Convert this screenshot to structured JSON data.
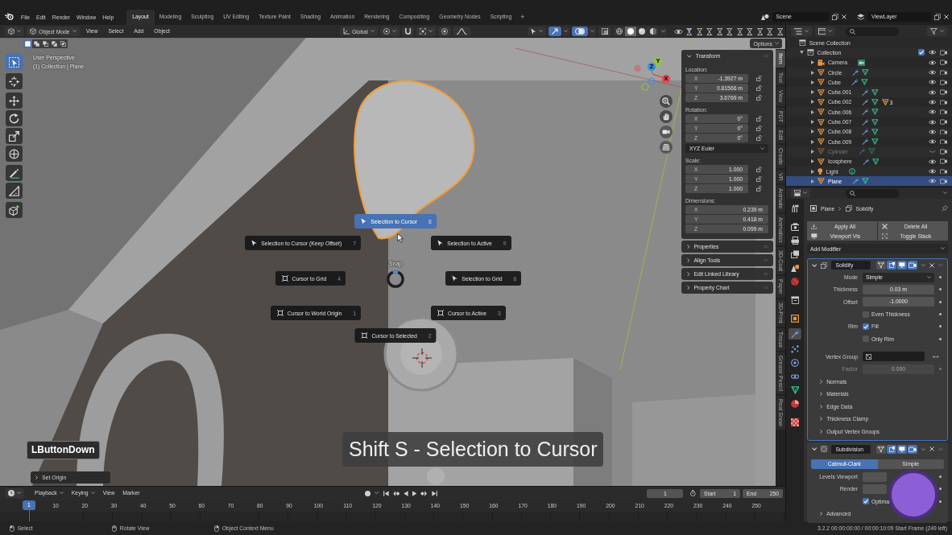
{
  "topbar": {
    "menus": [
      "File",
      "Edit",
      "Render",
      "Window",
      "Help"
    ],
    "workspaces": [
      {
        "label": "Layout",
        "selected": true
      },
      {
        "label": "Modeling",
        "selected": false
      },
      {
        "label": "Sculpting",
        "selected": false
      },
      {
        "label": "UV Editing",
        "selected": false
      },
      {
        "label": "Texture Paint",
        "selected": false
      },
      {
        "label": "Shading",
        "selected": false
      },
      {
        "label": "Animation",
        "selected": false
      },
      {
        "label": "Rendering",
        "selected": false
      },
      {
        "label": "Compositing",
        "selected": false
      },
      {
        "label": "Geometry Nodes",
        "selected": false
      },
      {
        "label": "Scripting",
        "selected": false
      }
    ],
    "add_workspace": "+",
    "scene": "Scene",
    "view_layer": "ViewLayer"
  },
  "viewport": {
    "header": {
      "mode": "Object Mode",
      "menus": [
        "View",
        "Select",
        "Add",
        "Object"
      ],
      "orientation": "Global",
      "snap_toggles": [
        {
          "kind": "snap",
          "on": false
        },
        {
          "kind": "proportional",
          "on": false
        }
      ],
      "display_toggles": [
        {
          "kind": "gizmos",
          "on": true
        },
        {
          "kind": "overlays",
          "on": true
        },
        {
          "kind": "xray",
          "on": false
        }
      ],
      "shading": [
        {
          "kind": "wireframe",
          "selected": false
        },
        {
          "kind": "solid",
          "selected": true
        },
        {
          "kind": "material",
          "selected": false
        },
        {
          "kind": "rendered",
          "selected": false
        }
      ],
      "visibility_toggles": [
        {
          "on": true
        },
        {
          "on": false
        },
        {
          "on": false
        },
        {
          "on": false
        },
        {
          "on": false
        },
        {
          "on": false
        },
        {
          "on": false
        },
        {
          "on": false
        },
        {
          "on": false
        },
        {
          "on": false
        }
      ]
    },
    "select_modes": [
      {
        "kind": "set",
        "selected": true
      },
      {
        "kind": "extend",
        "selected": false
      },
      {
        "kind": "subtract",
        "selected": false
      },
      {
        "kind": "invert",
        "selected": false
      },
      {
        "kind": "intersect",
        "selected": false
      }
    ],
    "options": "Options",
    "info": [
      "User Perspective",
      "(1) Collection | Plane"
    ],
    "tool_groups": [
      [
        {
          "kind": "select",
          "selected": true
        }
      ],
      [
        {
          "kind": "cursor",
          "selected": false
        }
      ],
      [
        {
          "kind": "move",
          "selected": false
        },
        {
          "kind": "rotate",
          "selected": false
        },
        {
          "kind": "scale",
          "selected": false
        },
        {
          "kind": "transform",
          "selected": false
        }
      ],
      [
        {
          "kind": "annotate",
          "selected": false
        },
        {
          "kind": "measure",
          "selected": false
        }
      ],
      [
        {
          "kind": "add-cube",
          "selected": false
        }
      ]
    ],
    "gizmo_axes": [
      "X",
      "Y",
      "Z"
    ],
    "pie_menu": {
      "title": "Snap",
      "items": [
        {
          "label": "Selection to Cursor",
          "key": "8",
          "kind": "selection",
          "selected": true
        },
        {
          "label": "Selection to Cursor (Keep Offset)",
          "key": "7",
          "kind": "selection",
          "selected": false
        },
        {
          "label": "Selection to Active",
          "key": "9",
          "kind": "selection",
          "selected": false
        },
        {
          "label": "Cursor to Grid",
          "key": "4",
          "kind": "cursor",
          "selected": false
        },
        {
          "label": "Selection to Grid",
          "key": "6",
          "kind": "selection",
          "selected": false
        },
        {
          "label": "Cursor to World Origin",
          "key": "1",
          "kind": "cursor",
          "selected": false
        },
        {
          "label": "Cursor to Active",
          "key": "3",
          "kind": "cursor",
          "selected": false
        },
        {
          "label": "Cursor to Selected",
          "key": "2",
          "kind": "cursor",
          "selected": false
        }
      ]
    },
    "keystroke": "LButtonDown",
    "last_operator": {
      "label": "Set Origin",
      "expanded": false
    },
    "caption": "Shift S - Selection to Cursor"
  },
  "sidebar": {
    "panels": [
      {
        "title": "Transform",
        "expanded": true,
        "groups": [
          {
            "label": "Location:",
            "rows": [
              {
                "axis": "X",
                "value": "-1.3927 m",
                "locked": false
              },
              {
                "axis": "Y",
                "value": "0.81566 m",
                "locked": false
              },
              {
                "axis": "Z",
                "value": "3.6769 m",
                "locked": false
              }
            ]
          },
          {
            "label": "Rotation:",
            "rows": [
              {
                "axis": "X",
                "value": "0°",
                "locked": false
              },
              {
                "axis": "Y",
                "value": "0°",
                "locked": false
              },
              {
                "axis": "Z",
                "value": "0°",
                "locked": false
              }
            ],
            "mode": "XYZ Euler"
          },
          {
            "label": "Scale:",
            "rows": [
              {
                "axis": "X",
                "value": "1.000",
                "locked": false
              },
              {
                "axis": "Y",
                "value": "1.000",
                "locked": false
              },
              {
                "axis": "Z",
                "value": "1.000",
                "locked": false
              }
            ]
          },
          {
            "label": "Dimensions:",
            "rows": [
              {
                "axis": "X",
                "value": "0.239 m"
              },
              {
                "axis": "Y",
                "value": "0.418 m"
              },
              {
                "axis": "Z",
                "value": "0.099 m"
              }
            ]
          }
        ]
      },
      {
        "title": "Properties",
        "expanded": false
      },
      {
        "title": "Align Tools",
        "expanded": false
      },
      {
        "title": "Edit Linked Library",
        "expanded": false
      },
      {
        "title": "Property Chart",
        "expanded": false
      }
    ],
    "tabs": [
      {
        "label": "Item",
        "selected": true
      },
      {
        "label": "Tool",
        "selected": false
      },
      {
        "label": "View",
        "selected": false
      },
      {
        "label": "PDT",
        "selected": false
      },
      {
        "label": "Edit",
        "selected": false
      },
      {
        "label": "Create",
        "selected": false
      },
      {
        "label": "VR",
        "selected": false
      },
      {
        "label": "Animate",
        "selected": false
      },
      {
        "label": "Animation",
        "selected": false
      },
      {
        "label": "3D-Coat",
        "selected": false
      },
      {
        "label": "Paper",
        "selected": false
      },
      {
        "label": "3D-Print",
        "selected": false
      },
      {
        "label": "Tissue",
        "selected": false
      },
      {
        "label": "Grease Pencil",
        "selected": false
      },
      {
        "label": "Real Snow",
        "selected": false
      }
    ]
  },
  "outliner": {
    "root": "Scene Collection",
    "collections": [
      {
        "label": "Collection",
        "expanded": true,
        "included": true,
        "hidden": false,
        "children": [
          {
            "label": "Camera",
            "kind": "camera",
            "selected": false,
            "hidden": false,
            "expanded": false,
            "data": [
              {
                "kind": "camera-data"
              }
            ]
          },
          {
            "label": "Circle",
            "kind": "mesh",
            "selected": false,
            "hidden": false,
            "expanded": false,
            "data": [
              {
                "kind": "modifier"
              },
              {
                "kind": "mesh"
              }
            ]
          },
          {
            "label": "Cube",
            "kind": "mesh",
            "selected": false,
            "hidden": false,
            "expanded": false,
            "data": [
              {
                "kind": "modifier"
              },
              {
                "kind": "mesh"
              }
            ]
          },
          {
            "label": "Cube.001",
            "kind": "mesh",
            "selected": false,
            "hidden": false,
            "expanded": false,
            "data": [
              {
                "kind": "modifier"
              },
              {
                "kind": "mesh"
              }
            ]
          },
          {
            "label": "Cube.002",
            "kind": "mesh",
            "selected": false,
            "hidden": false,
            "expanded": false,
            "data": [
              {
                "kind": "modifier"
              },
              {
                "kind": "mesh"
              },
              {
                "kind": "child-mesh",
                "count": "3"
              }
            ]
          },
          {
            "label": "Cube.006",
            "kind": "mesh",
            "selected": false,
            "hidden": false,
            "expanded": false,
            "data": [
              {
                "kind": "modifier"
              },
              {
                "kind": "mesh"
              }
            ]
          },
          {
            "label": "Cube.007",
            "kind": "mesh",
            "selected": false,
            "hidden": false,
            "expanded": false,
            "data": [
              {
                "kind": "modifier"
              },
              {
                "kind": "mesh"
              }
            ]
          },
          {
            "label": "Cube.008",
            "kind": "mesh",
            "selected": false,
            "hidden": false,
            "expanded": false,
            "data": [
              {
                "kind": "modifier"
              },
              {
                "kind": "mesh"
              }
            ]
          },
          {
            "label": "Cube.009",
            "kind": "mesh",
            "selected": false,
            "hidden": false,
            "expanded": false,
            "data": [
              {
                "kind": "modifier"
              },
              {
                "kind": "mesh"
              }
            ]
          },
          {
            "label": "Cylinder",
            "kind": "mesh",
            "selected": false,
            "hidden": true,
            "expanded": false,
            "data": [
              {
                "kind": "modifier"
              },
              {
                "kind": "mesh"
              }
            ]
          },
          {
            "label": "Icosphere",
            "kind": "mesh",
            "selected": false,
            "hidden": false,
            "expanded": false,
            "data": [
              {
                "kind": "modifier"
              },
              {
                "kind": "mesh"
              }
            ]
          },
          {
            "label": "Light",
            "kind": "light",
            "selected": false,
            "hidden": false,
            "expanded": false,
            "data": [
              {
                "kind": "light-data"
              }
            ]
          },
          {
            "label": "Plane",
            "kind": "mesh",
            "selected": true,
            "hidden": false,
            "expanded": false,
            "data": [
              {
                "kind": "modifier"
              },
              {
                "kind": "mesh"
              }
            ]
          }
        ]
      }
    ]
  },
  "properties": {
    "tab_groups": [
      [
        {
          "kind": "tool",
          "selected": false
        }
      ],
      [
        {
          "kind": "render",
          "selected": false
        },
        {
          "kind": "output",
          "selected": false
        },
        {
          "kind": "view-layer",
          "selected": false
        },
        {
          "kind": "scene",
          "selected": false
        },
        {
          "kind": "world",
          "selected": false
        }
      ],
      [
        {
          "kind": "collection",
          "selected": false
        }
      ],
      [
        {
          "kind": "object",
          "selected": false
        },
        {
          "kind": "modifiers",
          "selected": true
        },
        {
          "kind": "particles",
          "selected": false
        },
        {
          "kind": "physics",
          "selected": false
        },
        {
          "kind": "constraints",
          "selected": false
        },
        {
          "kind": "data",
          "selected": false
        },
        {
          "kind": "material",
          "selected": false
        }
      ],
      [
        {
          "kind": "texture",
          "selected": false
        }
      ]
    ],
    "breadcrumb": [
      {
        "kind": "object",
        "label": "Plane"
      },
      {
        "kind": "modifier",
        "label": "Solidify"
      }
    ],
    "actions": [
      {
        "kind": "apply",
        "label": "Apply All"
      },
      {
        "kind": "delete",
        "label": "Delete All"
      },
      {
        "kind": "viewport",
        "label": "Viewport Vis"
      },
      {
        "kind": "toggle-stack",
        "label": "Toggle Stack"
      }
    ],
    "add_modifier": "Add Modifier",
    "modifiers": [
      {
        "name": "Solidify",
        "kind": "solidify",
        "expanded": true,
        "active": true,
        "toggles": [
          {
            "kind": "on-cage",
            "on": false
          },
          {
            "kind": "edit-mode",
            "on": true
          },
          {
            "kind": "viewport",
            "on": true
          },
          {
            "kind": "render",
            "on": true
          }
        ],
        "rows": [
          {
            "kind": "dropdown",
            "label": "Mode",
            "value": "Simple",
            "disabled": false
          },
          {
            "kind": "number",
            "label": "Thickness",
            "value": "0.03 m",
            "disabled": false
          },
          {
            "kind": "number",
            "label": "Offset",
            "value": "-1.0000",
            "disabled": false
          },
          {
            "kind": "checkbox",
            "text": "Even Thickness",
            "checked": false,
            "disabled": false
          },
          {
            "kind": "checkbox",
            "label": "Rim",
            "text": "Fill",
            "checked": true,
            "disabled": false
          },
          {
            "kind": "checkbox",
            "text": "Only Rim",
            "checked": false,
            "disabled": false
          },
          {
            "kind": "group-field",
            "label": "Vertex Group",
            "disabled": false
          },
          {
            "kind": "number",
            "label": "Factor",
            "value": "0.000",
            "disabled": true
          }
        ],
        "subpanels": [
          {
            "label": "Normals",
            "expanded": false
          },
          {
            "label": "Materials",
            "expanded": false
          },
          {
            "label": "Edge Data",
            "expanded": false
          },
          {
            "label": "Thickness Clamp",
            "expanded": false
          },
          {
            "label": "Output Vertex Groups",
            "expanded": false
          }
        ]
      },
      {
        "name": "Subdivision",
        "kind": "subdivision",
        "expanded": true,
        "active": false,
        "toggles": [
          {
            "kind": "on-cage",
            "on": false
          },
          {
            "kind": "edit-mode",
            "on": true
          },
          {
            "kind": "viewport",
            "on": true
          },
          {
            "kind": "render",
            "on": true
          }
        ],
        "rows": [
          {
            "kind": "segmented",
            "options": [
              {
                "label": "Catmull-Clark",
                "selected": true
              },
              {
                "label": "Simple",
                "selected": false
              }
            ]
          },
          {
            "kind": "number",
            "label": "Levels Viewport",
            "disabled": false
          },
          {
            "kind": "number",
            "label": "Render",
            "disabled": false
          },
          {
            "kind": "checkbox",
            "text": "Optima",
            "checked": true,
            "disabled": false
          }
        ],
        "subpanels": [
          {
            "label": "Advanced",
            "expanded": false
          }
        ]
      }
    ]
  },
  "timeline": {
    "menus": [
      {
        "label": "Playback",
        "kind": "popover"
      },
      {
        "label": "Keying",
        "kind": "popover"
      },
      {
        "label": "View",
        "kind": "menu"
      },
      {
        "label": "Marker",
        "kind": "menu"
      }
    ],
    "current_frame": "1",
    "start_label": "Start",
    "start": "1",
    "end_label": "End",
    "end": "250",
    "playhead": "1",
    "ticks": [
      "10",
      "20",
      "30",
      "40",
      "50",
      "60",
      "70",
      "80",
      "90",
      "100",
      "110",
      "120",
      "130",
      "140",
      "150",
      "160",
      "170",
      "180",
      "190",
      "200",
      "210",
      "220",
      "230",
      "240",
      "250"
    ]
  },
  "status_bar": {
    "hints": [
      {
        "kind": "left",
        "label": "Select"
      },
      {
        "kind": "middle",
        "label": "Rotate View"
      },
      {
        "kind": "right",
        "label": "Object Context Menu"
      }
    ],
    "info": "3.2.2 00:00:00:00 / 00:00:10:09 Start Frame (249 left)"
  }
}
